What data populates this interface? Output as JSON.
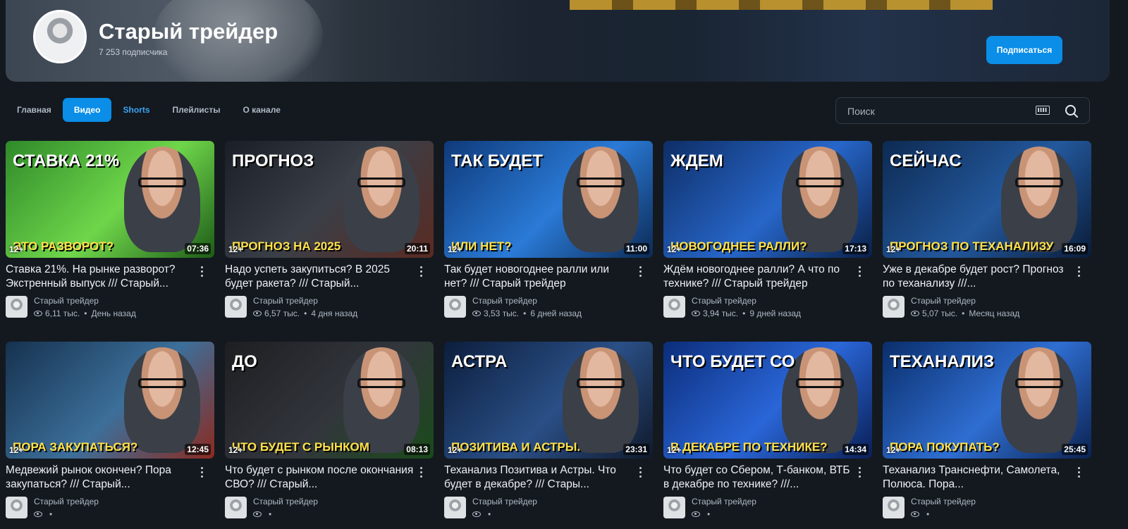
{
  "channel": {
    "title": "Старый трейдер",
    "subscribers": "7 253 подписчика",
    "subscribe_label": "Подписаться"
  },
  "tabs": [
    {
      "label": "Главная"
    },
    {
      "label": "Видео"
    },
    {
      "label": "Shorts"
    },
    {
      "label": "Плейлисты"
    },
    {
      "label": "О канале"
    }
  ],
  "search": {
    "placeholder": "Поиск"
  },
  "colors": {
    "accent": "#0a8ee8",
    "background": "#14191f"
  },
  "videos": [
    {
      "title": "Ставка 21%. На рынке разворот? Экстренный выпуск /// Старый...",
      "channel": "Старый трейдер",
      "views": "6,11 тыс.",
      "date": "День назад",
      "duration": "07:36",
      "age": "12+",
      "thumb_text": "СТАВКА 21%",
      "thumb_sub": "ЭТО РАЗВОРОТ?"
    },
    {
      "title": "Надо успеть закупиться? В 2025 будет ракета? /// Старый...",
      "channel": "Старый трейдер",
      "views": "6,57 тыс.",
      "date": "4 дня назад",
      "duration": "20:11",
      "age": "12+",
      "thumb_text": "ПРОГНОЗ",
      "thumb_sub": "ПРОГНОЗ НА 2025"
    },
    {
      "title": "Так будет новогоднее ралли или нет? /// Старый трейдер",
      "channel": "Старый трейдер",
      "views": "3,53 тыс.",
      "date": "6 дней назад",
      "duration": "11:00",
      "age": "12+",
      "thumb_text": "ТАК БУДЕТ",
      "thumb_sub": "ИЛИ НЕТ?"
    },
    {
      "title": "Ждём новогоднее ралли? А что по технике? /// Старый трейдер",
      "channel": "Старый трейдер",
      "views": "3,94 тыс.",
      "date": "9 дней назад",
      "duration": "17:13",
      "age": "12+",
      "thumb_text": "ЖДЕМ",
      "thumb_sub": "НОВОГОДНЕЕ РАЛЛИ?"
    },
    {
      "title": "Уже в декабре будет рост? Прогноз по теханализу ///...",
      "channel": "Старый трейдер",
      "views": "5,07 тыс.",
      "date": "Месяц назад",
      "duration": "16:09",
      "age": "12+",
      "thumb_text": "СЕЙЧАС",
      "thumb_sub": "ПРОГНОЗ ПО ТЕХАНАЛИЗУ"
    },
    {
      "title": "Медвежий рынок окончен? Пора закупаться? /// Старый...",
      "channel": "Старый трейдер",
      "views": "",
      "date": "",
      "duration": "12:45",
      "age": "12+",
      "thumb_text": "",
      "thumb_sub": "ПОРА ЗАКУПАТЬСЯ?"
    },
    {
      "title": "Что будет с рынком после окончания СВО? /// Старый...",
      "channel": "Старый трейдер",
      "views": "",
      "date": "",
      "duration": "08:13",
      "age": "12+",
      "thumb_text": "ДО",
      "thumb_sub": "ЧТО БУДЕТ С РЫНКОМ"
    },
    {
      "title": "Теханализ Позитива и Астры. Что будет в декабре? /// Стары...",
      "channel": "Старый трейдер",
      "views": "",
      "date": "",
      "duration": "23:31",
      "age": "12+",
      "thumb_text": "АСТРА",
      "thumb_sub": "ПОЗИТИВА И АСТРЫ."
    },
    {
      "title": "Что будет со Сбером, Т-банком, ВТБ в декабре по технике? ///...",
      "channel": "Старый трейдер",
      "views": "",
      "date": "",
      "duration": "14:34",
      "age": "12+",
      "thumb_text": "ЧТО БУДЕТ СО",
      "thumb_sub": "В ДЕКАБРЕ ПО ТЕХНИКЕ?"
    },
    {
      "title": "Теханализ Транснефти, Самолета, Полюса. Пора...",
      "channel": "Старый трейдер",
      "views": "",
      "date": "",
      "duration": "25:45",
      "age": "12+",
      "thumb_text": "ТЕХАНАЛИЗ",
      "thumb_sub": "ПОРА ПОКУПАТЬ?"
    }
  ]
}
